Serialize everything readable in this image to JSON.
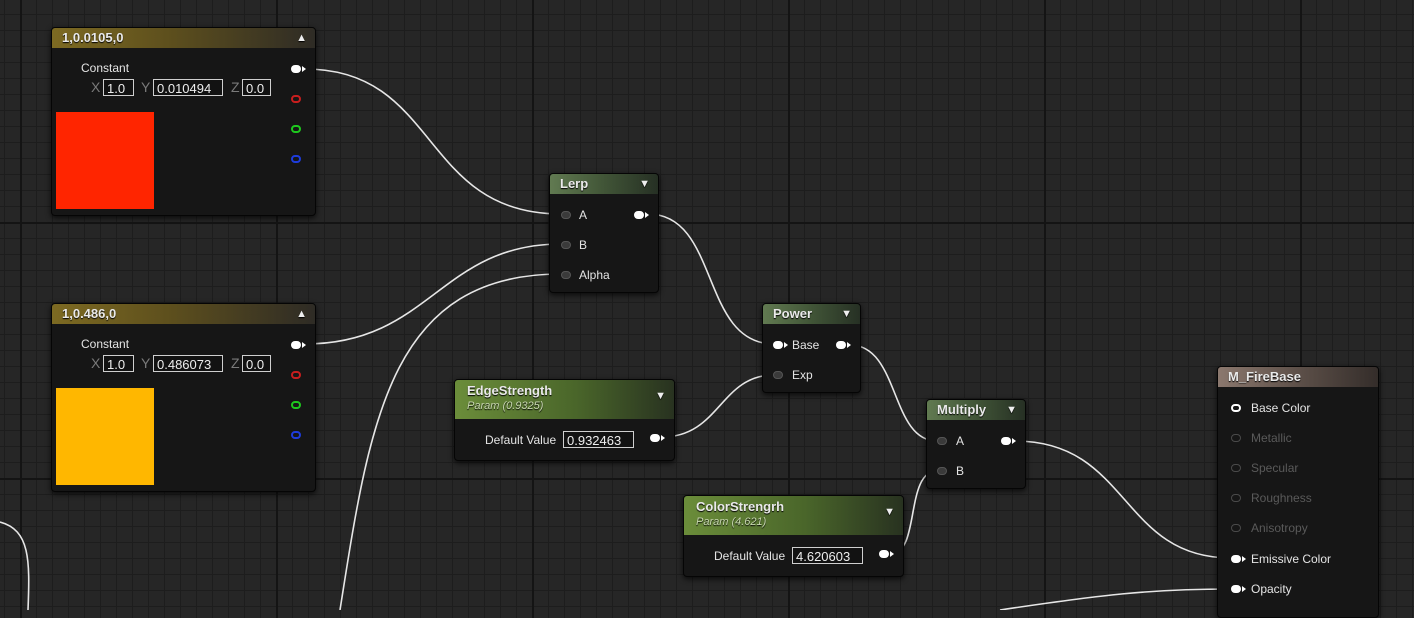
{
  "constant_nodes": [
    {
      "title": "1,0.0105,0",
      "label": "Constant",
      "x_axis": "X",
      "y_axis": "Y",
      "z_axis": "Z",
      "x": "1.0",
      "y": "0.010494",
      "z": "0.0",
      "color": "#ff2500"
    },
    {
      "title": "1,0.486,0",
      "label": "Constant",
      "x_axis": "X",
      "y_axis": "Y",
      "z_axis": "Z",
      "x": "1.0",
      "y": "0.486073",
      "z": "0.0",
      "color": "#ffb700"
    }
  ],
  "lerp": {
    "title": "Lerp",
    "inputs": [
      "A",
      "B",
      "Alpha"
    ]
  },
  "power": {
    "title": "Power",
    "inputs": [
      "Base",
      "Exp"
    ]
  },
  "multiply": {
    "title": "Multiply",
    "inputs": [
      "A",
      "B"
    ]
  },
  "edge_strength": {
    "title": "EdgeStrength",
    "subtitle": "Param (0.9325)",
    "default_label": "Default Value",
    "default_value": "0.932463"
  },
  "color_strength": {
    "title": "ColorStrengrh",
    "subtitle": "Param (4.621)",
    "default_label": "Default Value",
    "default_value": "4.620603"
  },
  "material": {
    "title": "M_FireBase",
    "pins": [
      {
        "label": "Base Color",
        "active": true
      },
      {
        "label": "Metallic",
        "active": false
      },
      {
        "label": "Specular",
        "active": false
      },
      {
        "label": "Roughness",
        "active": false
      },
      {
        "label": "Anisotropy",
        "active": false
      },
      {
        "label": "Emissive Color",
        "active": true
      },
      {
        "label": "Opacity",
        "active": true
      }
    ]
  },
  "colors": {
    "wire": "#e6e6e6",
    "pin_red": "#c81e1e",
    "pin_green": "#1ec81e",
    "pin_blue": "#1e3cdc"
  }
}
